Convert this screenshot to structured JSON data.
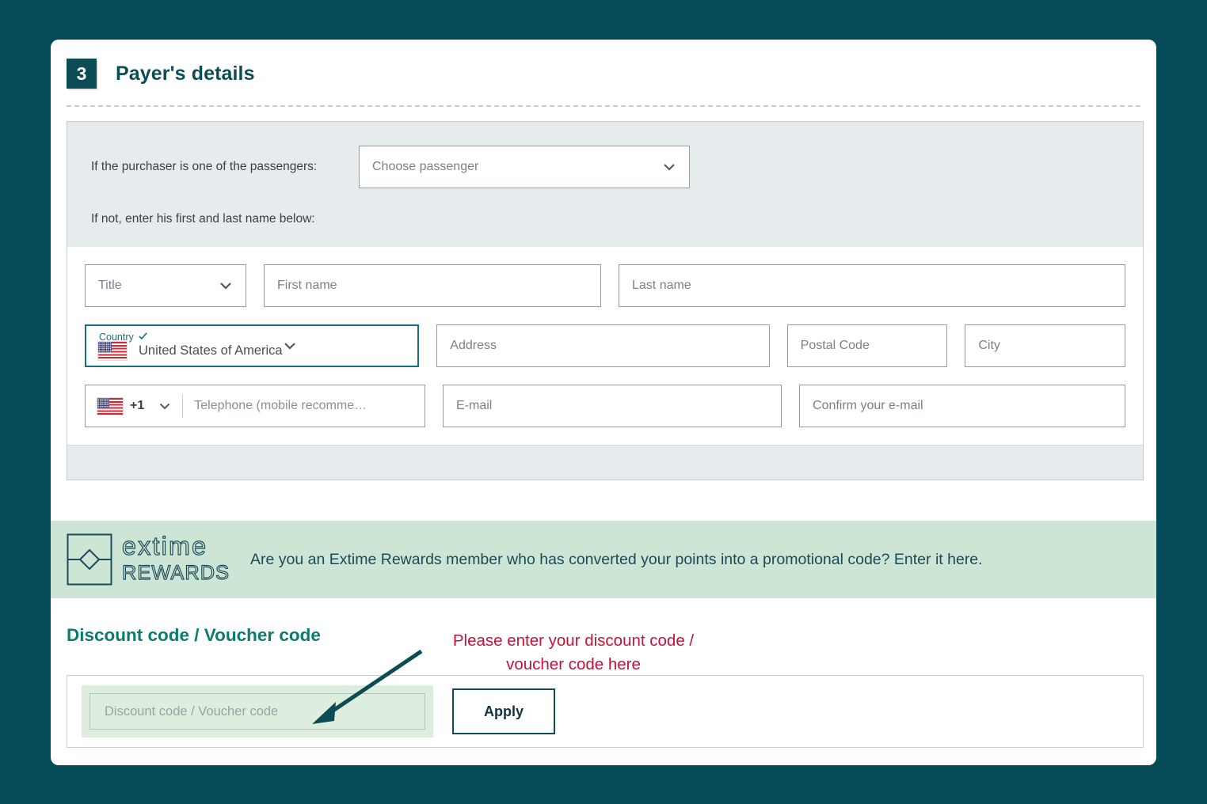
{
  "theme": {
    "page_background": "#044B57",
    "card_background": "#FFFFFF",
    "accent_teal": "#0B4C55",
    "country_focus": "#14707F",
    "rewards_banner": "#CDE5D5",
    "discount_title": "#0D7A6E",
    "annotation_red": "#C41238",
    "form_panel_grey": "#E6ECEE",
    "discount_field_green": "#DDEEDE"
  },
  "step": {
    "number": "3",
    "title": "Payer's details"
  },
  "purchaser": {
    "label": "If the purchaser is one of the passengers:",
    "select_value": "Choose passenger",
    "hint": "If not, enter his first and last name below:"
  },
  "fields": {
    "title": {
      "placeholder": "Title"
    },
    "first_name": {
      "placeholder": "First name"
    },
    "last_name": {
      "placeholder": "Last name"
    },
    "country": {
      "label": "Country",
      "value": "United States of America",
      "validated": true,
      "flag": "us-flag-icon"
    },
    "address": {
      "placeholder": "Address"
    },
    "postal_code": {
      "placeholder": "Postal Code"
    },
    "city": {
      "placeholder": "City"
    },
    "phone": {
      "country_code": "+1",
      "flag": "us-flag-icon",
      "placeholder": "Telephone (mobile recomme…"
    },
    "email": {
      "placeholder": "E-mail"
    },
    "confirm_email": {
      "placeholder": "Confirm your e-mail"
    }
  },
  "rewards": {
    "logo_word_top": "extime",
    "logo_word_bottom": "REWARDS",
    "message": "Are you an Extime Rewards member who has converted your points into a promotional code? Enter it here."
  },
  "discount": {
    "section_title": "Discount code / Voucher code",
    "input_placeholder": "Discount code / Voucher code",
    "apply_label": "Apply"
  },
  "annotation": {
    "text": "Please enter your discount code /\nvoucher code here"
  }
}
